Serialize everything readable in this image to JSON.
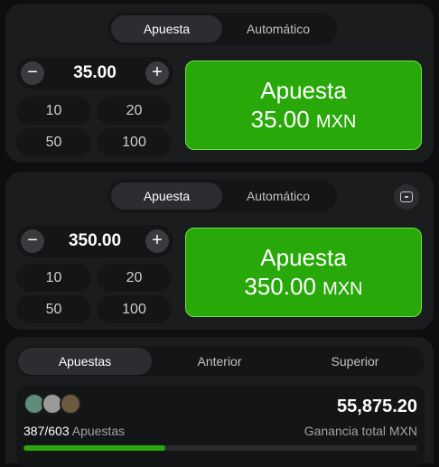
{
  "bet_panel_1": {
    "tabs": [
      "Apuesta",
      "Automático"
    ],
    "active_tab": 0,
    "amount": "35.00",
    "quick_amounts": [
      "10",
      "20",
      "50",
      "100"
    ],
    "bet_button": {
      "label": "Apuesta",
      "amount": "35.00",
      "currency": "MXN"
    }
  },
  "bet_panel_2": {
    "tabs": [
      "Apuesta",
      "Automático"
    ],
    "active_tab": 0,
    "amount": "350.00",
    "quick_amounts": [
      "10",
      "20",
      "50",
      "100"
    ],
    "bet_button": {
      "label": "Apuesta",
      "amount": "350.00",
      "currency": "MXN"
    }
  },
  "history": {
    "tabs": [
      "Apuestas",
      "Anterior",
      "Superior"
    ],
    "active_tab": 0,
    "bets_count": "387/603",
    "bets_label": "Apuestas",
    "total_win": "55,875.20",
    "total_label": "Ganancia total MXN",
    "progress_fraction": 0.36
  },
  "icons": {
    "minus": "−",
    "plus": "+"
  },
  "colors": {
    "bet_button": "#28a909",
    "background": "#0e0e10",
    "panel": "#1b1c1d"
  }
}
